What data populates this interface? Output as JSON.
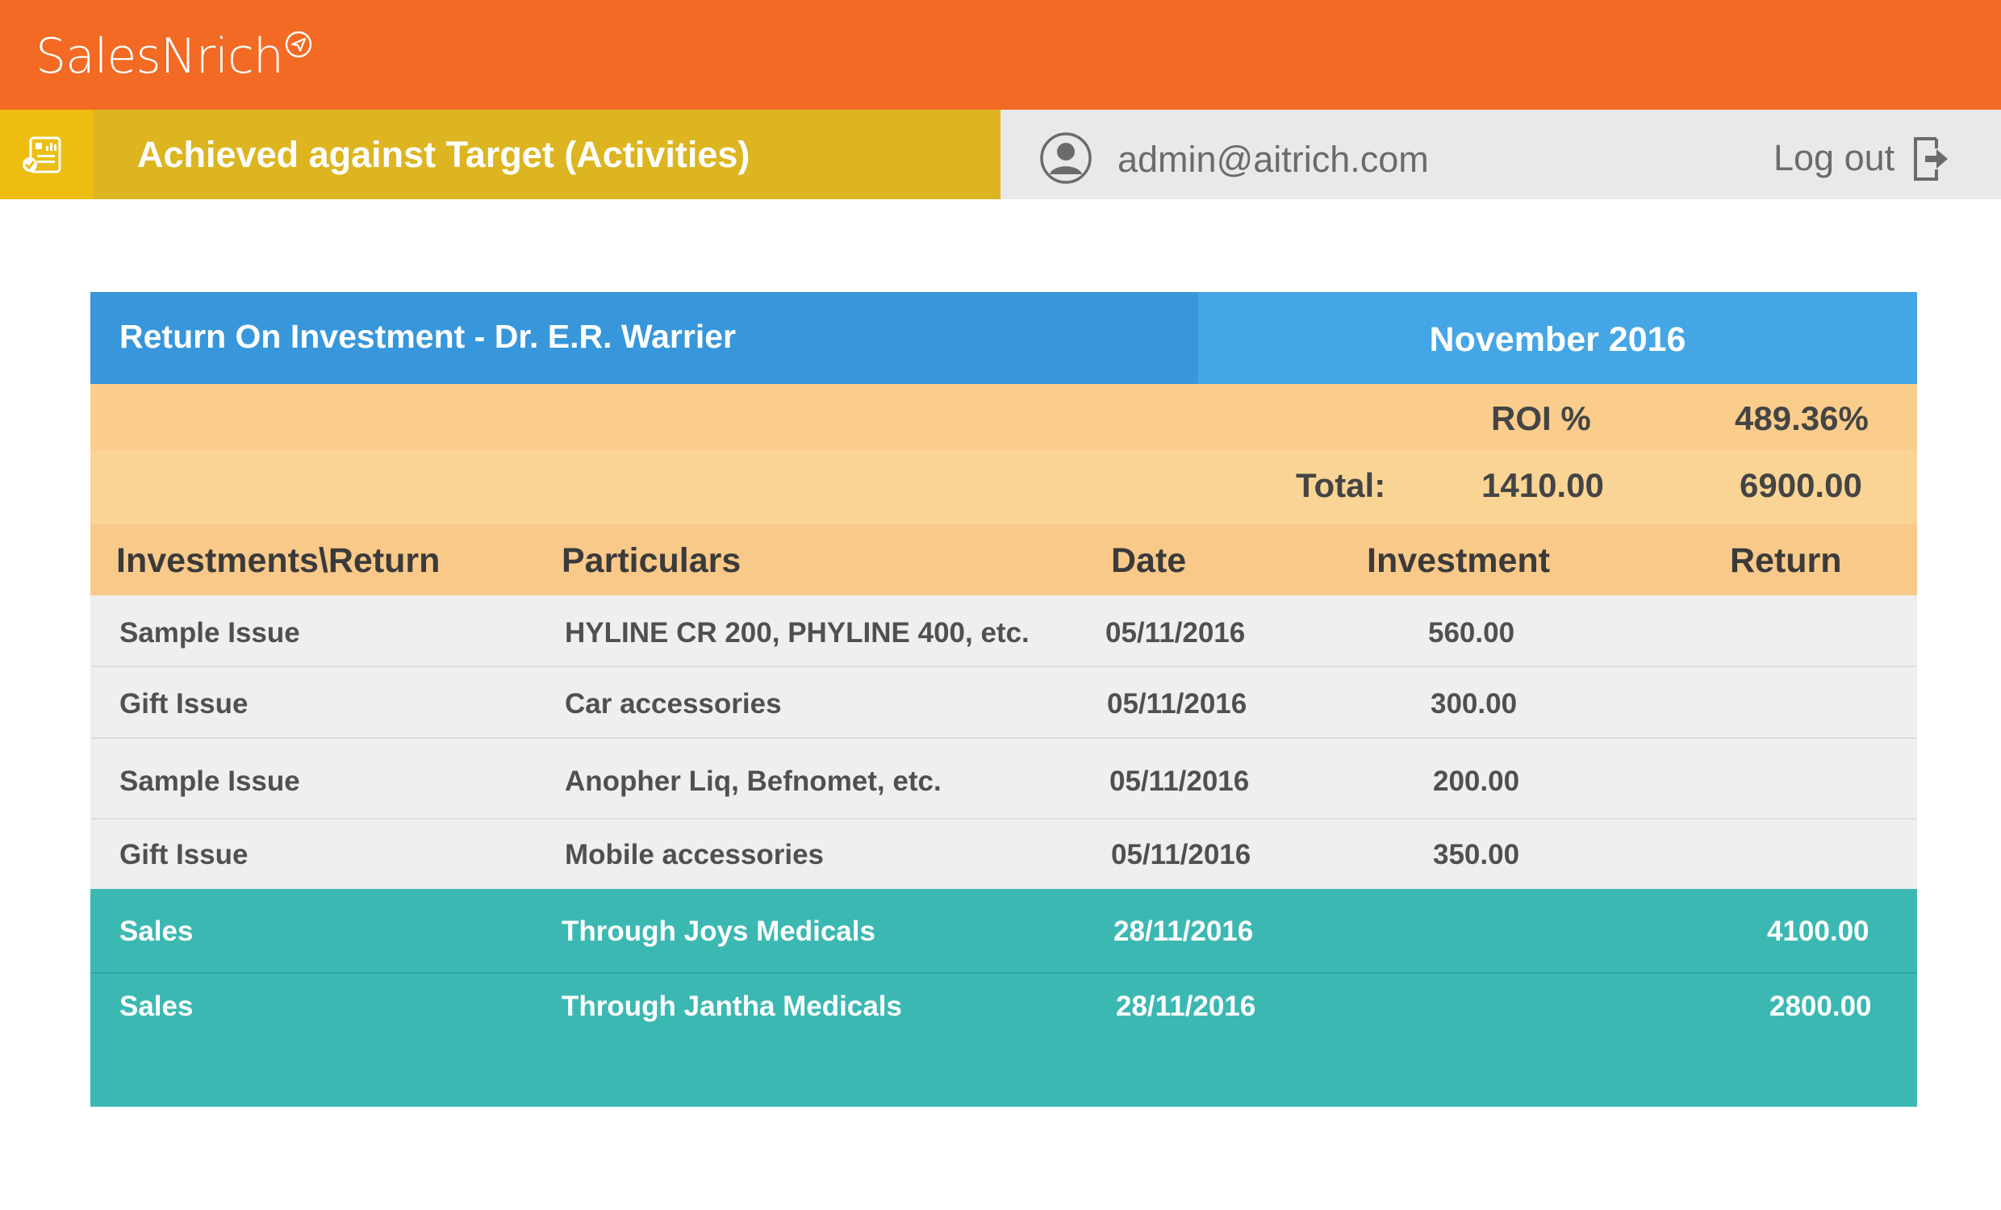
{
  "app": {
    "logo": "SalesNrich"
  },
  "header": {
    "title": "Achieved against Target (Activities)",
    "user_email": "admin@aitrich.com",
    "logout_label": "Log out"
  },
  "panel": {
    "title": "Return On Investment - Dr. E.R. Warrier",
    "month": "November 2016",
    "roi_label": "ROI %",
    "roi_value": "489.36%",
    "total_label": "Total:",
    "total_investment": "1410.00",
    "total_return": "6900.00"
  },
  "table": {
    "columns": [
      "Investments\\Return",
      "Particulars",
      "Date",
      "Investment",
      "Return"
    ],
    "rows": [
      {
        "type": "Sample Issue",
        "particulars": "HYLINE CR 200, PHYLINE 400, etc.",
        "date": "05/11/2016",
        "investment": "560.00",
        "return": ""
      },
      {
        "type": "Gift  Issue",
        "particulars": "Car accessories",
        "date": "05/11/2016",
        "investment": "300.00",
        "return": ""
      },
      {
        "type": "Sample Issue",
        "particulars": "Anopher Liq, Befnomet, etc.",
        "date": "05/11/2016",
        "investment": "200.00",
        "return": ""
      },
      {
        "type": "Gift  Issue",
        "particulars": "Mobile accessories",
        "date": "05/11/2016",
        "investment": "350.00",
        "return": ""
      },
      {
        "type": "Sales",
        "particulars": "Through Joys Medicals",
        "date": "28/11/2016",
        "investment": "",
        "return": "4100.00"
      },
      {
        "type": "Sales",
        "particulars": "Through Jantha Medicals",
        "date": "28/11/2016",
        "investment": "",
        "return": "2800.00"
      }
    ]
  },
  "colors": {
    "brand_orange": "#f26a24",
    "title_bar_yellow": "#dcb520",
    "header_blue": "#3797da",
    "summary_peach": "#facd8c",
    "sales_teal": "#3cb8b3"
  },
  "icons": {
    "logo_mark": "paper-plane-icon",
    "page_icon": "report-checklist-icon",
    "user": "user-avatar-icon",
    "logout": "logout-icon"
  }
}
